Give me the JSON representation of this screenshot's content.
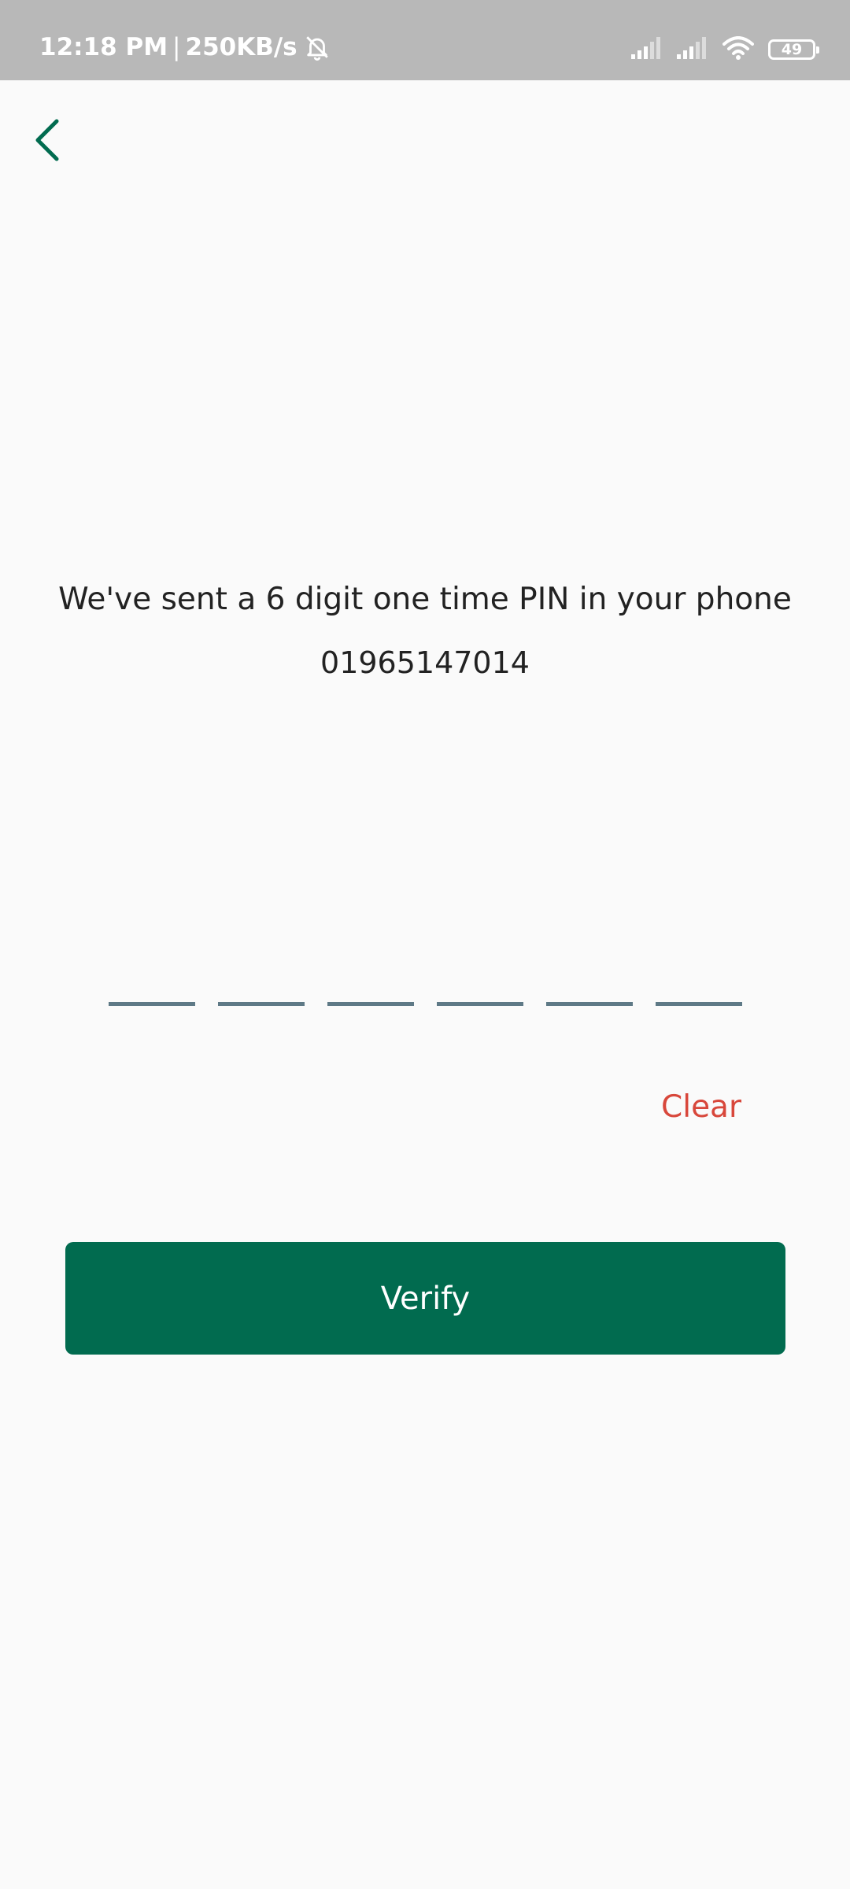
{
  "status_bar": {
    "time": "12:18 PM",
    "separator": "|",
    "network_speed": "250KB/s",
    "battery_level": "49",
    "icons": [
      "bell-off-icon",
      "signal-icon",
      "signal-icon",
      "wifi-icon",
      "battery-icon"
    ]
  },
  "header": {
    "back_icon": "chevron-left-icon"
  },
  "message": {
    "text": "We've sent a 6 digit one time PIN in your phone",
    "phone_number": "01965147014"
  },
  "pin_input": {
    "digits": [
      "",
      "",
      "",
      "",
      "",
      ""
    ]
  },
  "actions": {
    "clear_label": "Clear",
    "verify_label": "Verify"
  },
  "colors": {
    "accent": "#016b4f",
    "clear": "#d8473b",
    "pin_underline": "#5e7986",
    "status_bar": "#b8b8b8",
    "background": "#fafafa"
  }
}
